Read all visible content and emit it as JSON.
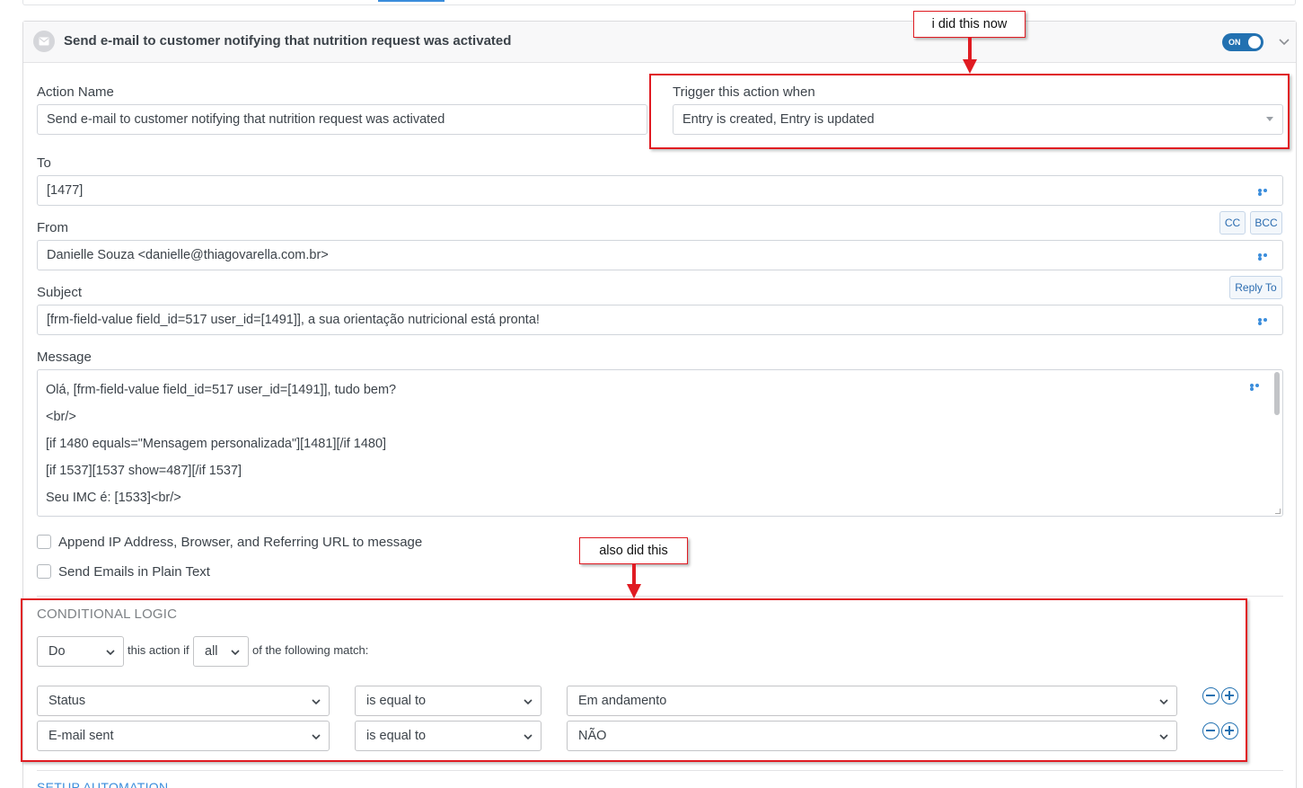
{
  "action": {
    "title": "Send e-mail to customer notifying that nutrition request was activated",
    "toggle_label": "ON"
  },
  "fields": {
    "action_name_label": "Action Name",
    "action_name_value": "Send e-mail to customer notifying that nutrition request was activated",
    "trigger_label": "Trigger this action when",
    "trigger_value": "Entry is created, Entry is updated",
    "to_label": "To",
    "to_value": "[1477]",
    "from_label": "From",
    "from_value": "Danielle Souza <danielle@thiagovarella.com.br>",
    "cc_label": "CC",
    "bcc_label": "BCC",
    "reply_to_label": "Reply To",
    "subject_label": "Subject",
    "subject_value": "[frm-field-value field_id=517 user_id=[1491]], a sua orientação nutricional está pronta!",
    "message_label": "Message",
    "message_lines": [
      "Olá, [frm-field-value field_id=517 user_id=[1491]], tudo bem?",
      "<br/>",
      "[if 1480 equals=\"Mensagem personalizada\"][1481][/if 1480]",
      "[if 1537][1537 show=487][/if 1537]",
      "Seu IMC é: [1533]<br/>"
    ]
  },
  "options": {
    "append_ip": "Append IP Address, Browser, and Referring URL to message",
    "plain_text": "Send Emails in Plain Text"
  },
  "conditional": {
    "heading": "CONDITIONAL LOGIC",
    "do_value": "Do",
    "this_action_if": "this action if",
    "match_value": "all",
    "following_match": "of the following match:",
    "rows": [
      {
        "field": "Status",
        "operator": "is equal to",
        "value": "Em andamento"
      },
      {
        "field": "E-mail sent",
        "operator": "is equal to",
        "value": "NÃO"
      }
    ]
  },
  "setup_heading": "SETUP AUTOMATION",
  "annotations": {
    "callout_1": "i did this now",
    "callout_2": "also did this",
    "color": "#e01b22"
  },
  "colors": {
    "accent": "#2271b1",
    "link": "#3a8ddc"
  }
}
